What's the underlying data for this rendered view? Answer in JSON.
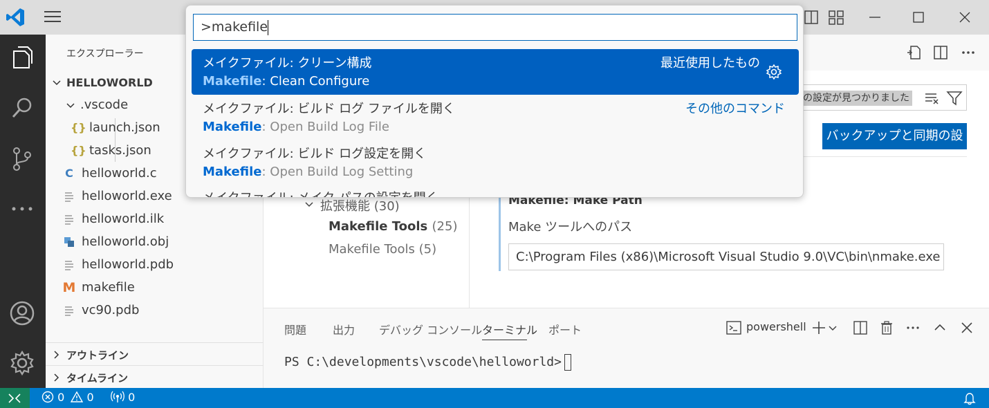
{
  "colors": {
    "accent": "#0066b8",
    "statusbar": "#007acc",
    "remote": "#16825d",
    "activitybar": "#2c2c2c"
  },
  "explorer": {
    "title": "エクスプローラー",
    "project": "HELLOWORLD",
    "items": [
      {
        "label": ".vscode",
        "icon": "folder-chevron-icon"
      },
      {
        "label": "launch.json",
        "icon": "json-icon"
      },
      {
        "label": "tasks.json",
        "icon": "json-icon"
      },
      {
        "label": "helloworld.c",
        "icon": "c-file-icon"
      },
      {
        "label": "helloworld.exe",
        "icon": "file-lines-icon"
      },
      {
        "label": "helloworld.ilk",
        "icon": "file-lines-icon"
      },
      {
        "label": "helloworld.obj",
        "icon": "obj-file-icon"
      },
      {
        "label": "helloworld.pdb",
        "icon": "file-lines-icon"
      },
      {
        "label": "makefile",
        "icon": "makefile-icon"
      },
      {
        "label": "vc90.pdb",
        "icon": "file-lines-icon"
      }
    ],
    "outline": "アウトライン",
    "timeline": "タイムライン"
  },
  "palette": {
    "input": ">makefile",
    "items": [
      {
        "line1": "メイクファイル: クリーン構成",
        "hl": "Makefile",
        "rest": ": Clean Configure",
        "right": "最近使用したもの"
      },
      {
        "line1": "メイクファイル: ビルド ログ ファイルを開く",
        "hl": "Makefile",
        "rest": ": Open Build Log File",
        "right": "その他のコマンド"
      },
      {
        "line1": "メイクファイル: ビルド ログ設定を開く",
        "hl": "Makefile",
        "rest": ": Open Build Log Setting"
      }
    ],
    "partial": "メイクファイル: メイク パスの設定を開く"
  },
  "settings": {
    "found": "個の設定が見つかりました",
    "backup": "バックアップと同期の設定",
    "toc": [
      {
        "label": "拡張機能",
        "count": "(30)"
      },
      {
        "label": "Makefile Tools",
        "count": "(25)"
      },
      {
        "label": "Makefile Tools",
        "count": "(5)"
      }
    ],
    "setting_title": "Makefile: Make Path",
    "setting_desc": "Make ツールへのパス",
    "setting_value": "C:\\Program Files (x86)\\Microsoft Visual Studio 9.0\\VC\\bin\\nmake.exe"
  },
  "panel": {
    "tabs": [
      "問題",
      "出力",
      "デバッグ コンソール",
      "ターミナル",
      "ポート"
    ],
    "shell": "powershell",
    "prompt": "PS C:\\developments\\vscode\\helloworld>"
  },
  "status": {
    "errors": "0",
    "warnings": "0",
    "ports": "0"
  }
}
